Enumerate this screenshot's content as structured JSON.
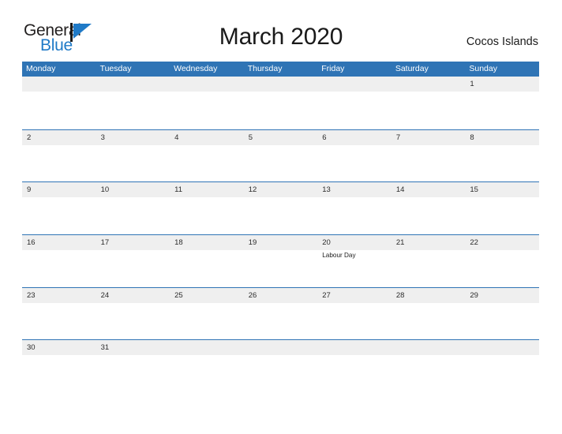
{
  "brand": {
    "name_part1": "General",
    "name_part2": "Blue",
    "flag_icon": "blue-triangle-flag",
    "color_dark": "#221f1f",
    "color_blue": "#1f7ac7"
  },
  "header": {
    "title": "March 2020",
    "region": "Cocos Islands"
  },
  "calendar": {
    "accent_color": "#2f74b5",
    "band_color": "#efefef",
    "weekday_headers": [
      "Monday",
      "Tuesday",
      "Wednesday",
      "Thursday",
      "Friday",
      "Saturday",
      "Sunday"
    ],
    "weeks": [
      {
        "days": [
          {
            "num": "",
            "events": []
          },
          {
            "num": "",
            "events": []
          },
          {
            "num": "",
            "events": []
          },
          {
            "num": "",
            "events": []
          },
          {
            "num": "",
            "events": []
          },
          {
            "num": "",
            "events": []
          },
          {
            "num": "1",
            "events": []
          }
        ]
      },
      {
        "days": [
          {
            "num": "2",
            "events": []
          },
          {
            "num": "3",
            "events": []
          },
          {
            "num": "4",
            "events": []
          },
          {
            "num": "5",
            "events": []
          },
          {
            "num": "6",
            "events": []
          },
          {
            "num": "7",
            "events": []
          },
          {
            "num": "8",
            "events": []
          }
        ]
      },
      {
        "days": [
          {
            "num": "9",
            "events": []
          },
          {
            "num": "10",
            "events": []
          },
          {
            "num": "11",
            "events": []
          },
          {
            "num": "12",
            "events": []
          },
          {
            "num": "13",
            "events": []
          },
          {
            "num": "14",
            "events": []
          },
          {
            "num": "15",
            "events": []
          }
        ]
      },
      {
        "days": [
          {
            "num": "16",
            "events": []
          },
          {
            "num": "17",
            "events": []
          },
          {
            "num": "18",
            "events": []
          },
          {
            "num": "19",
            "events": []
          },
          {
            "num": "20",
            "events": [
              "Labour Day"
            ]
          },
          {
            "num": "21",
            "events": []
          },
          {
            "num": "22",
            "events": []
          }
        ]
      },
      {
        "days": [
          {
            "num": "23",
            "events": []
          },
          {
            "num": "24",
            "events": []
          },
          {
            "num": "25",
            "events": []
          },
          {
            "num": "26",
            "events": []
          },
          {
            "num": "27",
            "events": []
          },
          {
            "num": "28",
            "events": []
          },
          {
            "num": "29",
            "events": []
          }
        ]
      },
      {
        "days": [
          {
            "num": "30",
            "events": []
          },
          {
            "num": "31",
            "events": []
          },
          {
            "num": "",
            "events": []
          },
          {
            "num": "",
            "events": []
          },
          {
            "num": "",
            "events": []
          },
          {
            "num": "",
            "events": []
          },
          {
            "num": "",
            "events": []
          }
        ]
      }
    ]
  }
}
